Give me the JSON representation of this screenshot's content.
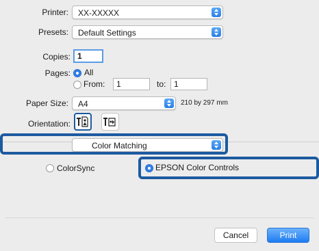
{
  "printer": {
    "label": "Printer:",
    "value": "XX-XXXXX"
  },
  "presets": {
    "label": "Presets:",
    "value": "Default Settings"
  },
  "copies": {
    "label": "Copies:",
    "value": "1"
  },
  "pages": {
    "label": "Pages:",
    "all_label": "All",
    "from_label": "From:",
    "from_value": "1",
    "to_label": "to:",
    "to_value": "1",
    "selected": "All"
  },
  "paper_size": {
    "label": "Paper Size:",
    "value": "A4",
    "dimensions": "210 by 297 mm"
  },
  "orientation": {
    "label": "Orientation:",
    "options": [
      "portrait-icon",
      "landscape-icon"
    ],
    "selected": "portrait-icon"
  },
  "panel": {
    "value": "Color Matching"
  },
  "color_matching": {
    "colorsync_label": "ColorSync",
    "epson_label": "EPSON Color Controls",
    "selected": "EPSON Color Controls"
  },
  "footer": {
    "cancel_label": "Cancel",
    "print_label": "Print"
  },
  "colors": {
    "accent": "#2f7fe8",
    "highlight": "#1d5aa0",
    "background": "#ececec"
  }
}
